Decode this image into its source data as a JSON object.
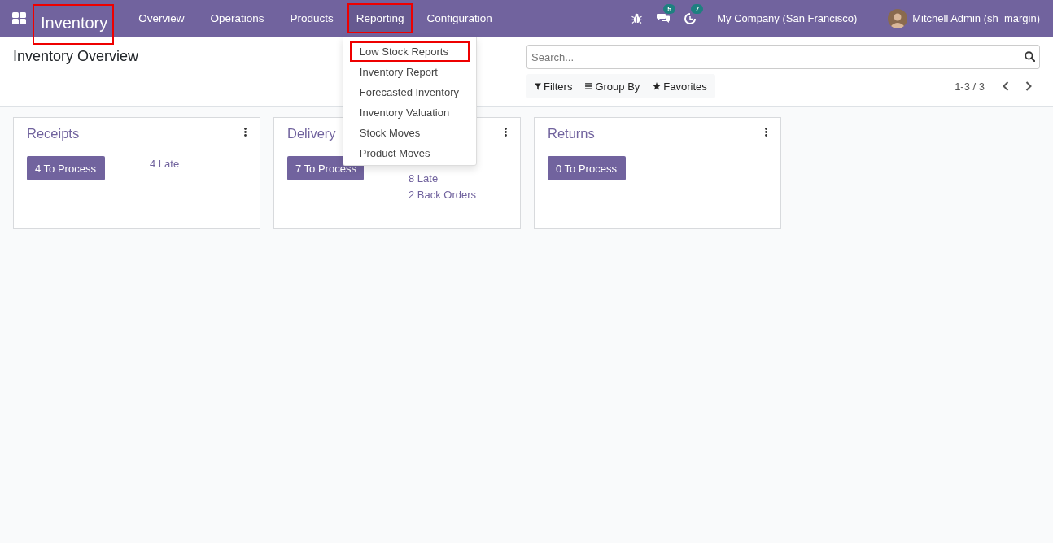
{
  "navbar": {
    "brand": {
      "label": "Inventory",
      "highlighted": true
    },
    "menu": [
      {
        "label": "Overview",
        "selected": false,
        "highlighted": false
      },
      {
        "label": "Operations",
        "selected": false,
        "highlighted": false
      },
      {
        "label": "Products",
        "selected": false,
        "highlighted": false
      },
      {
        "label": "Reporting",
        "selected": true,
        "highlighted": true
      },
      {
        "label": "Configuration",
        "selected": false,
        "highlighted": false
      }
    ],
    "systray": [
      {
        "kind": "debug"
      },
      {
        "kind": "messages",
        "badge": "5"
      },
      {
        "kind": "activities",
        "badge": "7"
      }
    ],
    "company": "My Company (San Francisco)",
    "user": "Mitchell Admin (sh_margin)"
  },
  "dropdown": {
    "items": [
      {
        "label": "Low Stock Reports",
        "highlighted": true
      },
      {
        "label": "Inventory Report",
        "highlighted": false
      },
      {
        "label": "Forecasted Inventory",
        "highlighted": false
      },
      {
        "label": "Inventory Valuation",
        "highlighted": false
      },
      {
        "label": "Stock Moves",
        "highlighted": false
      },
      {
        "label": "Product Moves",
        "highlighted": false
      }
    ]
  },
  "control_panel": {
    "title": "Inventory Overview",
    "search": {
      "placeholder": "Search..."
    },
    "toggles": [
      {
        "kind": "filter",
        "label": "Filters"
      },
      {
        "kind": "groupby",
        "label": "Group By"
      },
      {
        "kind": "favorite",
        "label": "Favorites"
      }
    ],
    "pager": "1-3 / 3"
  },
  "cards": [
    {
      "title": "Receipts",
      "button": "4 To Process",
      "links": [
        "4 Late"
      ]
    },
    {
      "title": "Delivery",
      "button": "7 To Process",
      "links": [
        "8 Late",
        "2 Back Orders"
      ]
    },
    {
      "title": "Returns",
      "button": "0 To Process"
    }
  ]
}
